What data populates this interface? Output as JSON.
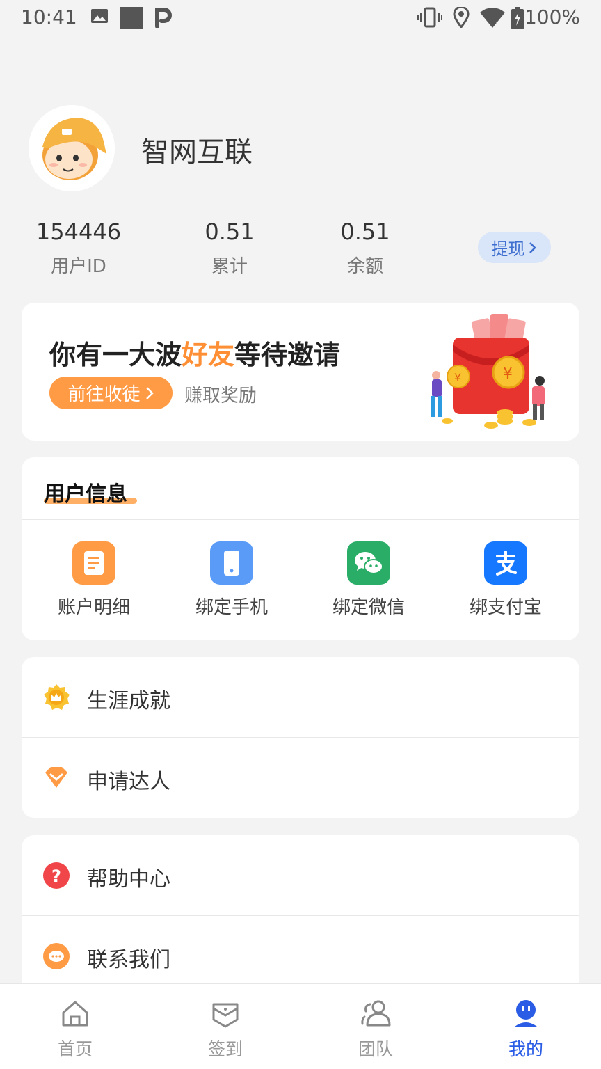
{
  "status_bar": {
    "time": "10:41",
    "battery": "100%",
    "icons": [
      "image-icon",
      "square-icon",
      "parking-icon",
      "vibrate-icon",
      "location-icon",
      "wifi-icon",
      "battery-icon"
    ]
  },
  "profile": {
    "username": "智网互联",
    "avatar": "cartoon-boy-avatar"
  },
  "stats": [
    {
      "value": "154446",
      "label": "用户ID"
    },
    {
      "value": "0.51",
      "label": "累计"
    },
    {
      "value": "0.51",
      "label": "余额"
    }
  ],
  "withdraw": {
    "label": "提现"
  },
  "invite": {
    "title_pre": "你有一大波",
    "title_highlight": "好友",
    "title_post": "等待邀请",
    "button": "前往收徒",
    "subtitle": "赚取奖励",
    "illustration": "red-envelope-coins-illustration"
  },
  "user_info": {
    "title": "用户信息",
    "items": [
      {
        "label": "账户明细",
        "icon": "document-icon",
        "color": "#ff9a45"
      },
      {
        "label": "绑定手机",
        "icon": "phone-icon",
        "color": "#5b9bf8"
      },
      {
        "label": "绑定微信",
        "icon": "wechat-icon",
        "color": "#2aae67"
      },
      {
        "label": "绑支付宝",
        "icon": "alipay-icon",
        "color": "#1677ff"
      }
    ]
  },
  "menu1": [
    {
      "label": "生涯成就",
      "icon": "crown-badge-icon"
    },
    {
      "label": "申请达人",
      "icon": "diamond-icon"
    }
  ],
  "menu2": [
    {
      "label": "帮助中心",
      "icon": "help-icon"
    },
    {
      "label": "联系我们",
      "icon": "chat-icon"
    }
  ],
  "tabs": [
    {
      "label": "首页",
      "icon": "home-icon"
    },
    {
      "label": "签到",
      "icon": "checkin-icon"
    },
    {
      "label": "团队",
      "icon": "team-icon"
    },
    {
      "label": "我的",
      "icon": "profile-icon",
      "active": true
    }
  ],
  "colors": {
    "accent_blue": "#2a5ce6",
    "accent_orange": "#ff9a45",
    "highlight_orange": "#ff8f35"
  }
}
